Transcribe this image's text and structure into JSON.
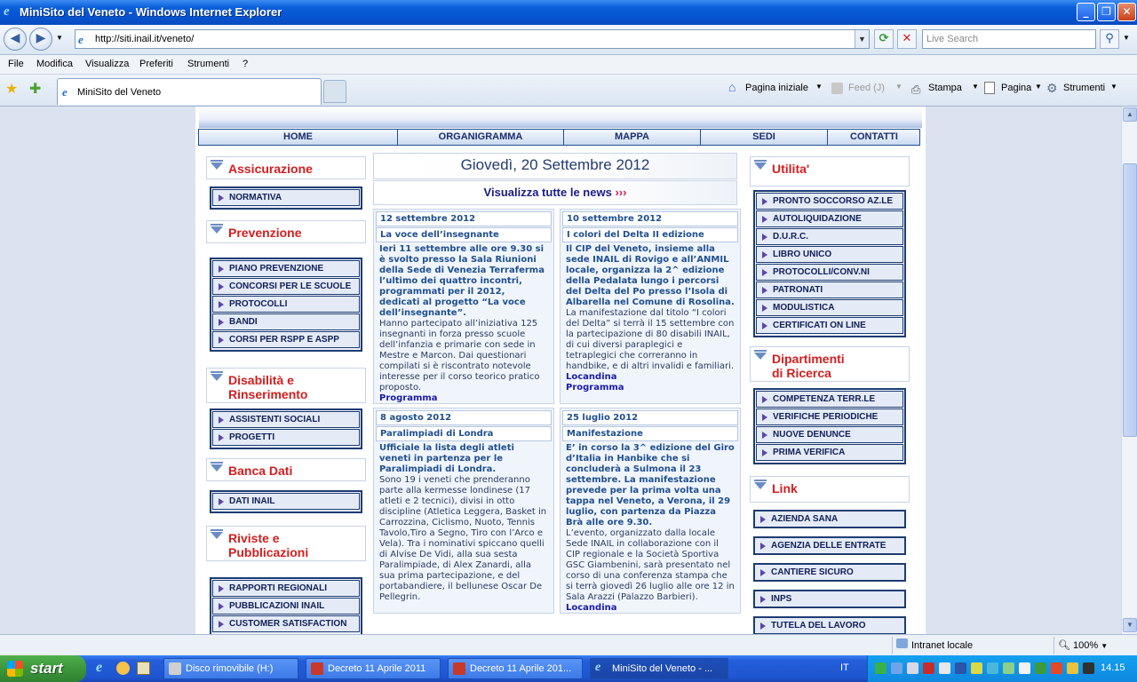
{
  "window": {
    "title": "MiniSito del Veneto - Windows Internet Explorer",
    "ie_glyph": "e"
  },
  "address": {
    "url": "http://siti.inail.it/veneto/",
    "search_placeholder": "Live Search"
  },
  "menu": [
    "File",
    "Modifica",
    "Visualizza",
    "Preferiti",
    "Strumenti",
    "?"
  ],
  "tab": {
    "label": "MiniSito del Veneto"
  },
  "commands": {
    "home": "Pagina iniziale",
    "feed": "Feed (J)",
    "print": "Stampa",
    "page": "Pagina",
    "tools": "Strumenti"
  },
  "nav": [
    "HOME",
    "ORGANIGRAMMA",
    "MAPPA",
    "SEDI",
    "CONTATTI"
  ],
  "left": {
    "assicurazione": {
      "title": "Assicurazione",
      "items": [
        "NORMATIVA"
      ]
    },
    "prevenzione": {
      "title": "Prevenzione",
      "items": [
        "PIANO PREVENZIONE",
        "CONCORSI PER LE SCUOLE",
        "PROTOCOLLI",
        "BANDI",
        "CORSI PER RSPP E ASPP"
      ]
    },
    "disabilita": {
      "title_1": "Disabilità e",
      "title_2": "Rinserimento",
      "items": [
        "ASSISTENTI SOCIALI",
        "PROGETTI"
      ]
    },
    "banca": {
      "title": "Banca Dati",
      "items": [
        "DATI INAIL"
      ]
    },
    "riviste": {
      "title_1": "Riviste e",
      "title_2": "Pubblicazioni",
      "items": [
        "RAPPORTI REGIONALI",
        "PUBBLICAZIONI INAIL",
        "CUSTOMER SATISFACTION"
      ]
    }
  },
  "center": {
    "date": "Giovedì, 20 Settembre 2012",
    "all_news": "Visualizza tutte le news",
    "all_news_arrow": "›››",
    "news": [
      {
        "date": "12 settembre 2012",
        "title": "La voce dell’insegnante",
        "bold": "Ieri 11 settembre alle ore 9.30 si è svolto presso la Sala Riunioni della Sede di Venezia Terraferma l’ultimo dei quattro incontri, programmati per il 2012, dedicati al progetto “La voce dell’insegnante”.",
        "text": "Hanno partecipato all’iniziativa 125 insegnanti in forza presso scuole dell’infanzia e primarie con sede in Mestre e Marcon. Dai questionari compilati si è riscontrato notevole interesse per il corso teorico pratico proposto.",
        "links": [
          "Programma"
        ]
      },
      {
        "date": "10 settembre 2012",
        "title": "I colori del Delta II edizione",
        "bold": "Il CIP del Veneto, insieme alla sede INAIL di Rovigo e all’ANMIL locale, organizza la 2^ edizione della Pedalata lungo i percorsi del Delta del Po presso l’Isola di Albarella nel Comune di Rosolina.",
        "text": "La manifestazione dal titolo “I colori del Delta” si terrà il 15 settembre con la partecipazione di 80 disabili INAIL, di cui diversi paraplegici e tetraplegici che correranno in handbike, e di altri invalidi e familiari.",
        "links": [
          "Locandina",
          "Programma"
        ]
      },
      {
        "date": "8 agosto 2012",
        "title": "Paralimpiadi di Londra",
        "bold": "Ufficiale la lista degli atleti veneti in partenza per le Paralimpiadi di Londra.",
        "text": "Sono 19 i veneti che prenderanno parte alla kermesse londinese (17 atleti e 2 tecnici), divisi in otto discipline (Atletica Leggera, Basket in Carrozzina, Ciclismo, Nuoto, Tennis Tavolo,Tiro a Segno, Tiro con l’Arco e Vela). Tra i nominativi spiccano quelli di Alvise De Vidi, alla sua sesta Paralimpiade, di Alex Zanardi, alla sua prima partecipazione, e del portabandiere, il bellunese Oscar De Pellegrin.",
        "links": []
      },
      {
        "date": "25 luglio 2012",
        "title": "Manifestazione",
        "bold": "E’ in corso la 3^ edizione del Giro d’Italia in Hanbike che si concluderà a Sulmona il 23 settembre. La manifestazione prevede per la prima volta una tappa nel Veneto, a Verona, il 29 luglio, con partenza da Piazza Brà alle ore 9.30.",
        "text": "L’evento, organizzato dalla locale Sede INAIL in collaborazione con il CIP regionale e la Società Sportiva GSC Giambenini, sarà presentato nel corso di una conferenza stampa che si terrà giovedì 26 luglio alle ore 12 in Sala Arazzi (Palazzo Barbieri).",
        "links": [
          "Locandina"
        ]
      }
    ]
  },
  "right": {
    "utilita": {
      "title": "Utilita'",
      "items": [
        "PRONTO SOCCORSO AZ.LE",
        "AUTOLIQUIDAZIONE",
        "D.U.R.C.",
        "LIBRO  UNICO",
        "PROTOCOLLI/CONV.NI",
        "PATRONATI",
        "MODULISTICA",
        "CERTIFICATI ON LINE"
      ]
    },
    "dipartimenti": {
      "title_1": "Dipartimenti",
      "title_2": "di Ricerca",
      "items": [
        "COMPETENZA TERR.LE",
        "VERIFICHE PERIODICHE",
        "NUOVE DENUNCE",
        "PRIMA VERIFICA"
      ]
    },
    "link": {
      "title": "Link",
      "items": [
        "AZIENDA SANA",
        "AGENZIA  DELLE  ENTRATE",
        "CANTIERE  SICURO",
        "INPS",
        "TUTELA  DEL LAVORO"
      ]
    }
  },
  "status": {
    "zone": "Intranet locale",
    "zoom": "100%"
  },
  "taskbar": {
    "start": "start",
    "items": [
      "Disco rimovibile (H:)",
      "Decreto 11 Aprile 2011",
      "Decreto 11 Aprile 201...",
      "MiniSito del Veneto - ..."
    ],
    "lang": "IT",
    "clock": "14.15"
  }
}
